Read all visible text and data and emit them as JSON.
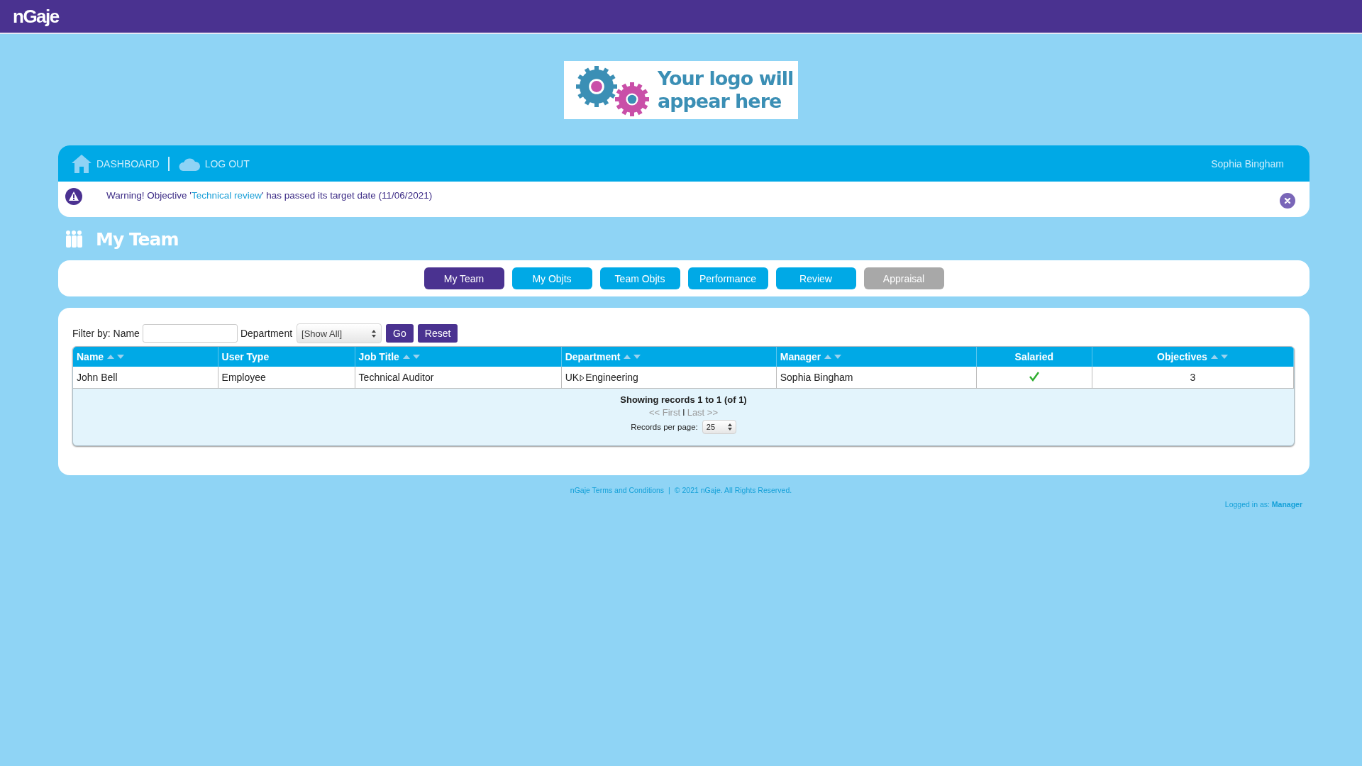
{
  "brand": {
    "name": "nGaje"
  },
  "logo_placeholder": {
    "line_1": "Your logo will",
    "line_2": "appear here"
  },
  "nav": {
    "items": [
      {
        "kind": "home",
        "label": "DASHBOARD"
      },
      {
        "kind": "cloud",
        "label": "LOG OUT"
      }
    ],
    "user": "Sophia Bingham"
  },
  "warning": {
    "text": "Warning! Objective '",
    "link": "Technical review",
    "text_after": "' has passed its target date (11/06/2021)"
  },
  "page_title": "My Team",
  "tabs": [
    {
      "label": "My Team",
      "selected": true,
      "disabled": false
    },
    {
      "label": "My Objts",
      "selected": false,
      "disabled": false
    },
    {
      "label": "Team Objts",
      "selected": false,
      "disabled": false
    },
    {
      "label": "Performance",
      "selected": false,
      "disabled": false
    },
    {
      "label": "Review",
      "selected": false,
      "disabled": false
    },
    {
      "label": "Appraisal",
      "selected": false,
      "disabled": true
    }
  ],
  "filter": {
    "name_label": "Filter by: Name",
    "department_label": "Department",
    "department_value": "[Show All]",
    "buttons": [
      "Go",
      "Reset"
    ]
  },
  "table": {
    "columns": [
      {
        "label": "Name",
        "sortable": true
      },
      {
        "label": "User Type",
        "sortable": false
      },
      {
        "label": "Job Title",
        "sortable": true
      },
      {
        "label": "Department",
        "sortable": true
      },
      {
        "label": "Manager",
        "sortable": true
      },
      {
        "label": "Salaried",
        "sortable": false
      },
      {
        "label": "Objectives",
        "sortable": true
      }
    ],
    "rows": [
      {
        "name": "John Bell",
        "user_type": "Employee",
        "job_title": "Technical Auditor",
        "department_parent": "UK",
        "department": "Engineering",
        "manager": "Sophia Bingham",
        "salaried": true,
        "objectives": "3"
      }
    ],
    "summary": "Showing records 1 to 1 (of 1)",
    "pager": {
      "first": "<< First",
      "separator": "I",
      "last": "Last >>"
    },
    "per_page_label": "Records per page:",
    "per_page": "25"
  },
  "footer": {
    "terms": "nGaje Terms and Conditions",
    "separator": "|",
    "copyright": "© 2021 nGaje. All Rights Reserved.",
    "logged_in": "Logged in as: **Manager**"
  }
}
